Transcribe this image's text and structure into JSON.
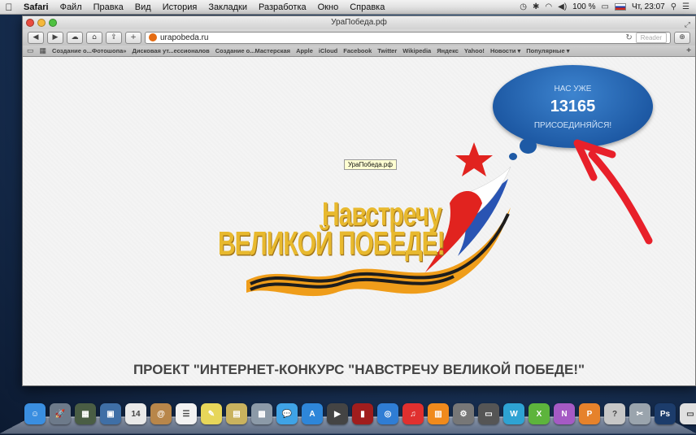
{
  "menubar": {
    "apple": "",
    "items": [
      "Safari",
      "Файл",
      "Правка",
      "Вид",
      "История",
      "Закладки",
      "Разработка",
      "Окно",
      "Справка"
    ],
    "battery": "100 %",
    "clock": "Чт, 23:07"
  },
  "window": {
    "title": "УраПобеда.рф",
    "url": "urapobeda.ru",
    "reader_label": "Reader",
    "bookmarks": [
      "Создание о...Фотошопа»",
      "Дисковая ут...ессионалов",
      "Создание о...Мастерская",
      "Apple",
      "iCloud",
      "Facebook",
      "Twitter",
      "Wikipedia",
      "Яндекс",
      "Yahoo!",
      "Новости ▾",
      "Популярные ▾"
    ]
  },
  "page": {
    "counter": {
      "top_text": "НАС УЖЕ",
      "count": "13165",
      "cta": "ПРИСОЕДИНЯЙСЯ!"
    },
    "tooltip": "УраПобеда.рф",
    "logo_line1": "Навстречу",
    "logo_line2": "ВЕЛИКОЙ ПОБЕДЕ!",
    "headline": "ПРОЕКТ \"ИНТЕРНЕТ-КОНКУРС \"НАВСТРЕЧУ ВЕЛИКОЙ ПОБЕДЕ!\""
  },
  "dock": {
    "icons": [
      {
        "name": "finder-icon",
        "label": "☺",
        "color": "#3a8ee0"
      },
      {
        "name": "launchpad-icon",
        "label": "🚀",
        "color": "#6d7a8a"
      },
      {
        "name": "mission-control-icon",
        "label": "▦",
        "color": "#4a5d44"
      },
      {
        "name": "preview-icon",
        "label": "▣",
        "color": "#3f6fa6"
      },
      {
        "name": "calendar-icon",
        "label": "14",
        "color": "#e9e9e9"
      },
      {
        "name": "contacts-icon",
        "label": "@",
        "color": "#b8864a"
      },
      {
        "name": "reminders-icon",
        "label": "☰",
        "color": "#f2f2f2"
      },
      {
        "name": "notes-icon",
        "label": "✎",
        "color": "#e7d65a"
      },
      {
        "name": "stickies-icon",
        "label": "▤",
        "color": "#c9b25e"
      },
      {
        "name": "preview-app-icon",
        "label": "▩",
        "color": "#8c9aa8"
      },
      {
        "name": "messages-icon",
        "label": "💬",
        "color": "#3fa3e6"
      },
      {
        "name": "app-store-icon",
        "label": "A",
        "color": "#2e86d9"
      },
      {
        "name": "facetime-icon",
        "label": "▶",
        "color": "#444"
      },
      {
        "name": "photo-booth-icon",
        "label": "▮",
        "color": "#a01d1d"
      },
      {
        "name": "safari-icon",
        "label": "◎",
        "color": "#2f7dd4"
      },
      {
        "name": "itunes-icon",
        "label": "♫",
        "color": "#e0302f"
      },
      {
        "name": "ibooks-icon",
        "label": "▥",
        "color": "#f08a1c"
      },
      {
        "name": "system-preferences-icon",
        "label": "⚙",
        "color": "#777"
      },
      {
        "name": "terminal-icon",
        "label": "▭",
        "color": "#555"
      },
      {
        "name": "word-icon",
        "label": "W",
        "color": "#2ea3d3"
      },
      {
        "name": "excel-icon",
        "label": "X",
        "color": "#5db43c"
      },
      {
        "name": "onenote-icon",
        "label": "N",
        "color": "#a55ac4"
      },
      {
        "name": "powerpoint-icon",
        "label": "P",
        "color": "#e6822b"
      },
      {
        "name": "help-icon",
        "label": "?",
        "color": "#c7c7c7"
      },
      {
        "name": "utility-icon",
        "label": "✂",
        "color": "#9aa4ad"
      },
      {
        "name": "photoshop-icon",
        "label": "Ps",
        "color": "#1c3c6b"
      },
      {
        "name": "documents-icon",
        "label": "▭",
        "color": "#e0e0e0"
      },
      {
        "name": "trash-icon",
        "label": "🗑",
        "color": "#9aa0a6"
      }
    ]
  }
}
